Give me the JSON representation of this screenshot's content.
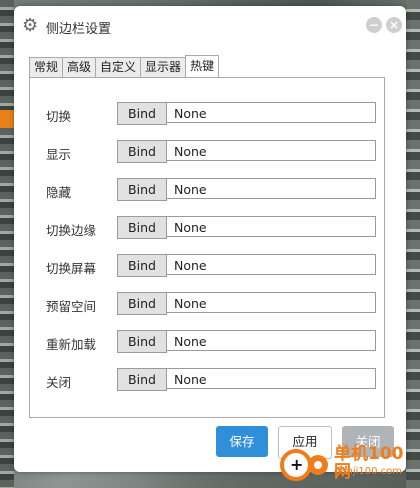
{
  "window": {
    "title": "侧边栏设置",
    "title_icon": "gear-icon"
  },
  "tabs": [
    {
      "label": "常规",
      "active": false
    },
    {
      "label": "高级",
      "active": false
    },
    {
      "label": "自定义",
      "active": false
    },
    {
      "label": "显示器",
      "active": false
    },
    {
      "label": "热键",
      "active": true
    }
  ],
  "hotkeys": [
    {
      "label": "切换",
      "button": "Bind",
      "value": "None"
    },
    {
      "label": "显示",
      "button": "Bind",
      "value": "None"
    },
    {
      "label": "隐藏",
      "button": "Bind",
      "value": "None"
    },
    {
      "label": "切换边缘",
      "button": "Bind",
      "value": "None"
    },
    {
      "label": "切换屏幕",
      "button": "Bind",
      "value": "None"
    },
    {
      "label": "预留空间",
      "button": "Bind",
      "value": "None"
    },
    {
      "label": "重新加载",
      "button": "Bind",
      "value": "None"
    },
    {
      "label": "关闭",
      "button": "Bind",
      "value": "None"
    }
  ],
  "footer": {
    "save": "保存",
    "apply": "应用",
    "close": "关闭"
  },
  "watermark": {
    "name": "单机100网",
    "url": "danji100.com"
  },
  "colors": {
    "accent": "#2f8fd8",
    "watermark": "#f07d1a",
    "close_button": "#aeb4b8"
  }
}
